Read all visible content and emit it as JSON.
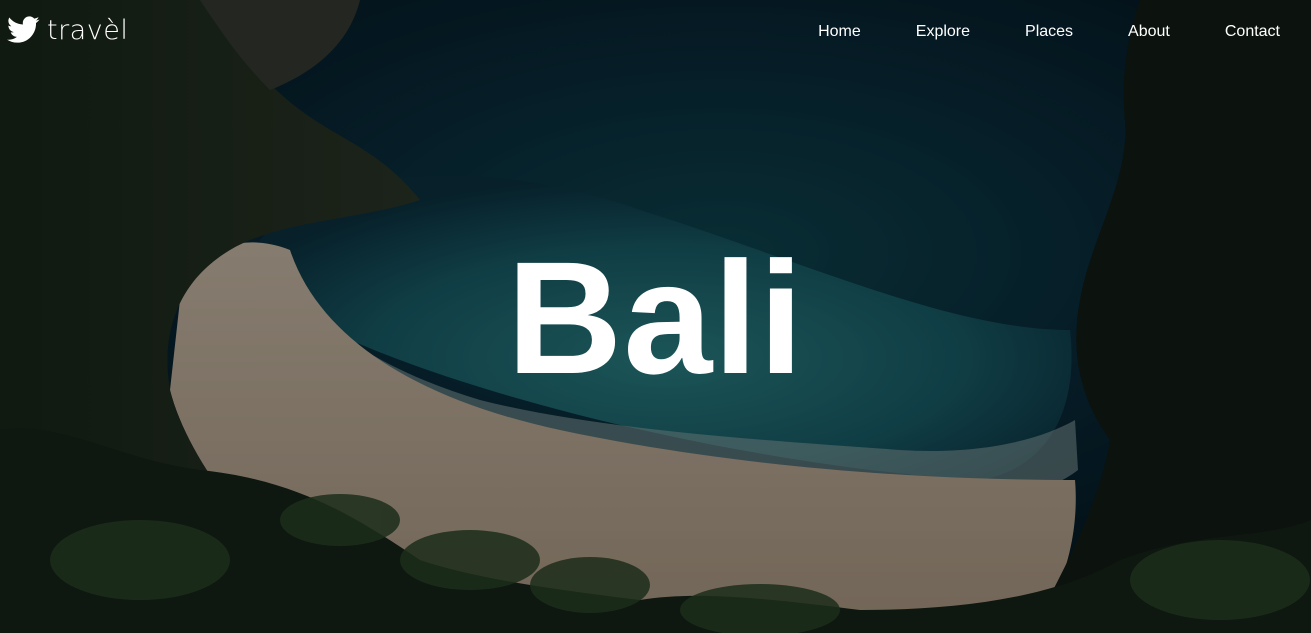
{
  "brand": {
    "name": "travèl",
    "icon": "bird-icon"
  },
  "nav": {
    "items": [
      {
        "label": "Home"
      },
      {
        "label": "Explore"
      },
      {
        "label": "Places"
      },
      {
        "label": "About"
      },
      {
        "label": "Contact"
      }
    ]
  },
  "hero": {
    "title": "Bali",
    "background": "aerial-beach-cove-photo"
  },
  "colors": {
    "text": "#ffffff",
    "overlay": "#000000",
    "water_deep": "#0b2a3a",
    "water_shallow": "#1e6f78",
    "sand": "#cdbba6",
    "foliage": "#1b2a1c"
  }
}
